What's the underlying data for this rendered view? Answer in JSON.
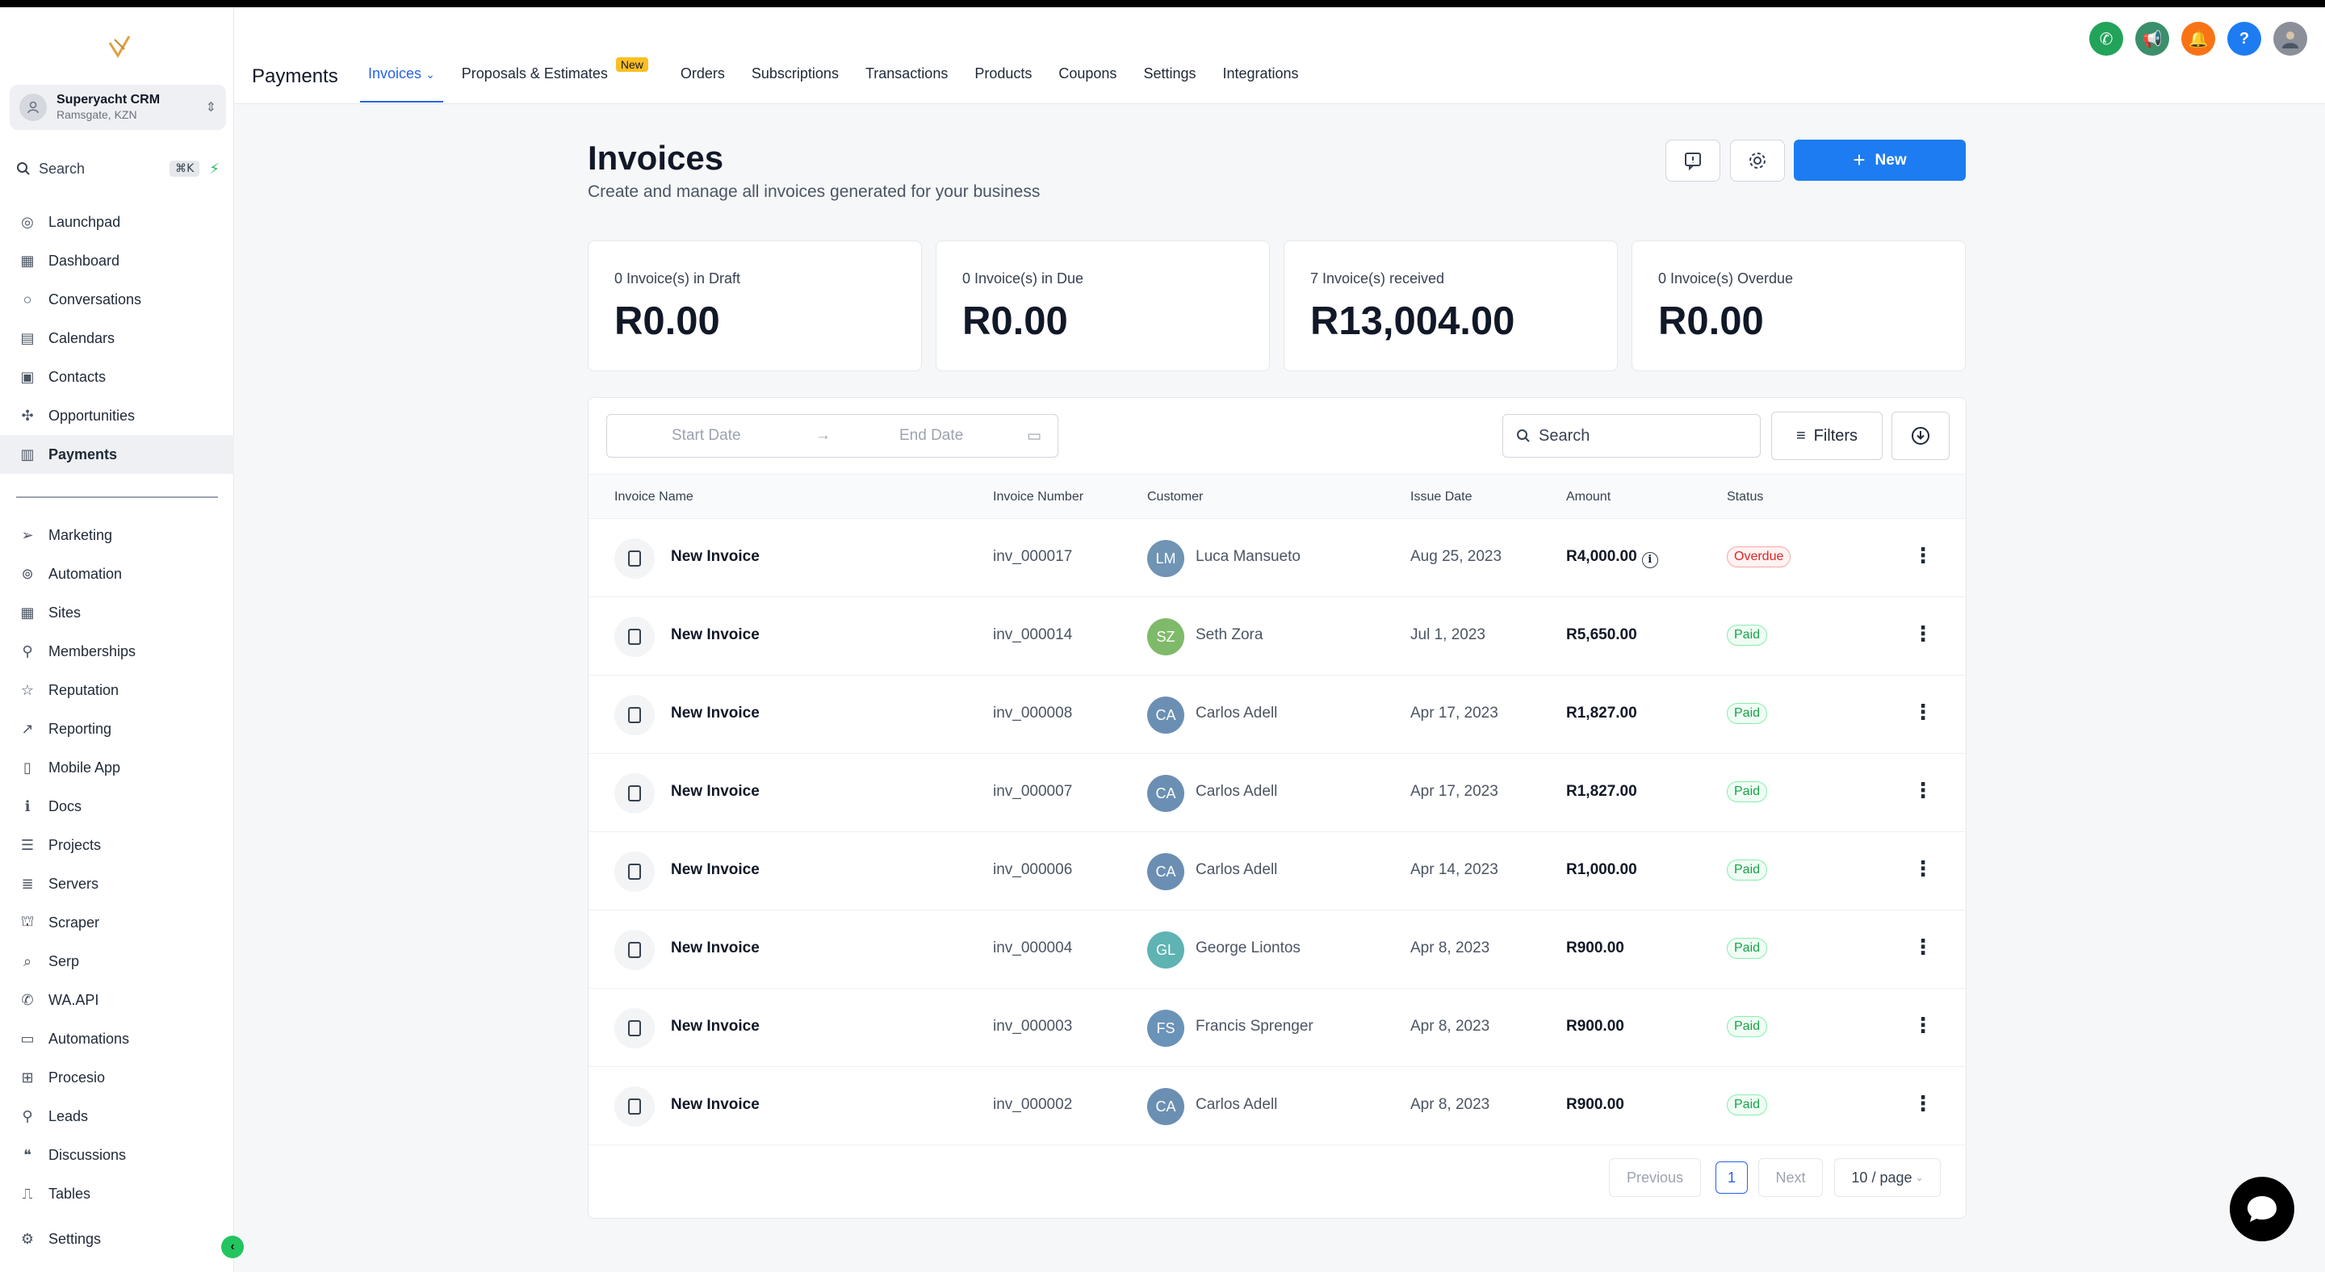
{
  "sidebar": {
    "account_name": "Superyacht CRM",
    "account_location": "Ramsgate, KZN",
    "search_placeholder": "Search",
    "search_shortcut": "⌘K",
    "items": [
      {
        "label": "Launchpad",
        "icon": "rocket-icon"
      },
      {
        "label": "Dashboard",
        "icon": "grid-icon"
      },
      {
        "label": "Conversations",
        "icon": "chat-icon"
      },
      {
        "label": "Calendars",
        "icon": "calendar-icon"
      },
      {
        "label": "Contacts",
        "icon": "contacts-icon"
      },
      {
        "label": "Opportunities",
        "icon": "network-icon"
      },
      {
        "label": "Payments",
        "icon": "receipt-icon"
      }
    ],
    "items2": [
      {
        "label": "Marketing",
        "icon": "send-icon"
      },
      {
        "label": "Automation",
        "icon": "automation-icon"
      },
      {
        "label": "Sites",
        "icon": "sites-icon"
      },
      {
        "label": "Memberships",
        "icon": "award-icon"
      },
      {
        "label": "Reputation",
        "icon": "star-icon"
      },
      {
        "label": "Reporting",
        "icon": "trend-icon"
      },
      {
        "label": "Mobile App",
        "icon": "mobile-icon"
      },
      {
        "label": "Docs",
        "icon": "info-icon"
      },
      {
        "label": "Projects",
        "icon": "list-icon"
      },
      {
        "label": "Servers",
        "icon": "server-icon"
      },
      {
        "label": "Scraper",
        "icon": "scraper-icon"
      },
      {
        "label": "Serp",
        "icon": "search-zoom-icon"
      },
      {
        "label": "WA.API",
        "icon": "whatsapp-icon"
      },
      {
        "label": "Automations",
        "icon": "monitor-icon"
      },
      {
        "label": "Procesio",
        "icon": "procesio-icon"
      },
      {
        "label": "Leads",
        "icon": "walk-icon"
      },
      {
        "label": "Discussions",
        "icon": "comments-icon"
      },
      {
        "label": "Tables",
        "icon": "pulse-icon"
      }
    ],
    "settings_label": "Settings"
  },
  "header": {
    "section_title": "Payments",
    "tabs": [
      "Invoices",
      "Proposals & Estimates",
      "Orders",
      "Subscriptions",
      "Transactions",
      "Products",
      "Coupons",
      "Settings",
      "Integrations"
    ],
    "new_badge": "New",
    "help_label": "?"
  },
  "main": {
    "title": "Invoices",
    "subtitle": "Create and manage all invoices generated for your business",
    "new_button": "New",
    "stats": [
      {
        "label": "0 Invoice(s) in Draft",
        "value": "R0.00"
      },
      {
        "label": "0 Invoice(s) in Due",
        "value": "R0.00"
      },
      {
        "label": "7 Invoice(s) received",
        "value": "R13,004.00"
      },
      {
        "label": "0 Invoice(s) Overdue",
        "value": "R0.00"
      }
    ],
    "start_date_placeholder": "Start Date",
    "end_date_placeholder": "End Date",
    "search_placeholder": "Search",
    "filters_label": "Filters",
    "columns": [
      "Invoice Name",
      "Invoice Number",
      "Customer",
      "Issue Date",
      "Amount",
      "Status"
    ],
    "rows": [
      {
        "name": "New Invoice",
        "number": "inv_000017",
        "initials": "LM",
        "customer": "Luca Mansueto",
        "date": "Aug 25, 2023",
        "amount": "R4,000.00",
        "status": "Overdue"
      },
      {
        "name": "New Invoice",
        "number": "inv_000014",
        "initials": "SZ",
        "customer": "Seth Zora",
        "date": "Jul 1, 2023",
        "amount": "R5,650.00",
        "status": "Paid"
      },
      {
        "name": "New Invoice",
        "number": "inv_000008",
        "initials": "CA",
        "customer": "Carlos Adell",
        "date": "Apr 17, 2023",
        "amount": "R1,827.00",
        "status": "Paid"
      },
      {
        "name": "New Invoice",
        "number": "inv_000007",
        "initials": "CA",
        "customer": "Carlos Adell",
        "date": "Apr 17, 2023",
        "amount": "R1,827.00",
        "status": "Paid"
      },
      {
        "name": "New Invoice",
        "number": "inv_000006",
        "initials": "CA",
        "customer": "Carlos Adell",
        "date": "Apr 14, 2023",
        "amount": "R1,000.00",
        "status": "Paid"
      },
      {
        "name": "New Invoice",
        "number": "inv_000004",
        "initials": "GL",
        "customer": "George Liontos",
        "date": "Apr 8, 2023",
        "amount": "R900.00",
        "status": "Paid"
      },
      {
        "name": "New Invoice",
        "number": "inv_000003",
        "initials": "FS",
        "customer": "Francis Sprenger",
        "date": "Apr 8, 2023",
        "amount": "R900.00",
        "status": "Paid"
      },
      {
        "name": "New Invoice",
        "number": "inv_000002",
        "initials": "CA",
        "customer": "Carlos Adell",
        "date": "Apr 8, 2023",
        "amount": "R900.00",
        "status": "Paid"
      }
    ],
    "pagination": {
      "previous": "Previous",
      "current": "1",
      "next": "Next",
      "page_size": "10 / page"
    }
  },
  "colors": {
    "accent": "#1d7cf2",
    "paid": "#16a34a",
    "overdue": "#dc2626",
    "avatar_LM": "#6f94b4",
    "avatar_SZ": "#7fba6a",
    "avatar_CA": "#6b8fb3",
    "avatar_GL": "#5fb3b3",
    "avatar_FS": "#6a93b8"
  }
}
